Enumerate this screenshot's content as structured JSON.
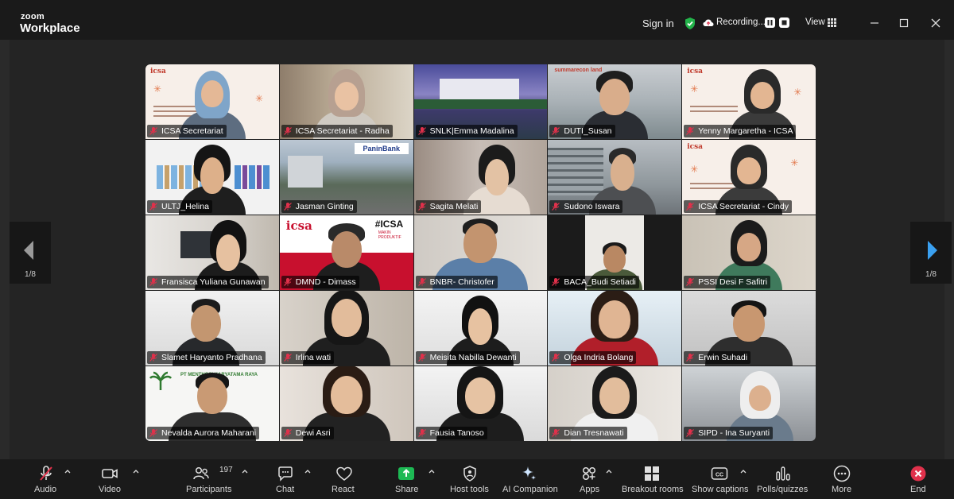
{
  "titlebar": {
    "logo_small": "zoom",
    "logo_big": "Workplace",
    "sign_in": "Sign in",
    "recording_label": "Recording...",
    "view_label": "View"
  },
  "nav": {
    "prev_page": "1/8",
    "next_page": "1/8"
  },
  "participants_grid": [
    {
      "name": "ICSA Secretariat",
      "type": "slide"
    },
    {
      "name": "ICSA Secretariat - Radha",
      "type": "person"
    },
    {
      "name": "SNLK|Emma Madalina",
      "type": "building"
    },
    {
      "name": "DUTI_Susan",
      "type": "person"
    },
    {
      "name": "Yenny Margaretha - ICSA",
      "type": "slide"
    },
    {
      "name": "ULTJ_Helina",
      "type": "person"
    },
    {
      "name": "Jasman Ginting",
      "type": "city"
    },
    {
      "name": "Sagita Melati",
      "type": "person"
    },
    {
      "name": "Sudono Iswara",
      "type": "person"
    },
    {
      "name": "ICSA Secretariat - Cindy",
      "type": "slide",
      "active": true
    },
    {
      "name": "Fransisca Yuliana Gunawan",
      "type": "person"
    },
    {
      "name": "DMND - Dimass",
      "type": "person"
    },
    {
      "name": "BNBR- Christofer",
      "type": "person"
    },
    {
      "name": "BACA_Budi Setiadi",
      "type": "person"
    },
    {
      "name": "PSSI Desi F Safitri",
      "type": "person"
    },
    {
      "name": "Slamet Haryanto Pradhana",
      "type": "person"
    },
    {
      "name": "Irlina wati",
      "type": "person"
    },
    {
      "name": "Meisita Nabilla Dewanti",
      "type": "person"
    },
    {
      "name": "Olga Indria Bolang",
      "type": "person"
    },
    {
      "name": "Erwin Suhadi",
      "type": "person"
    },
    {
      "name": "Nevalda Aurora Maharani",
      "type": "person"
    },
    {
      "name": "Dewi Asri",
      "type": "person"
    },
    {
      "name": "Fausia Tanoso",
      "type": "person"
    },
    {
      "name": "Dian Tresnawati",
      "type": "person"
    },
    {
      "name": "SIPD - Ina Suryanti",
      "type": "person"
    }
  ],
  "tile_texts": {
    "panin_logo": "PaninBank",
    "icsa_logo": "icsa",
    "icsa_hash": "#ICSA",
    "hash_sub": "MAKIN PRODUKTIF",
    "summarecon": "summarecon land",
    "pt_text": "PT MENTHOSI KARYATAMA RAYA"
  },
  "toolbar": {
    "audio": "Audio",
    "video": "Video",
    "participants": "Participants",
    "participants_count": "197",
    "chat": "Chat",
    "react": "React",
    "share": "Share",
    "host_tools": "Host tools",
    "ai_companion": "AI Companion",
    "apps": "Apps",
    "breakout_rooms": "Breakout rooms",
    "show_captions": "Show captions",
    "polls": "Polls/quizzes",
    "more": "More",
    "end": "End"
  },
  "colors": {
    "accent_green": "#23d18b",
    "share_green": "#1db954",
    "end_red": "#e0314b",
    "mic_off_red": "#e0314b"
  }
}
